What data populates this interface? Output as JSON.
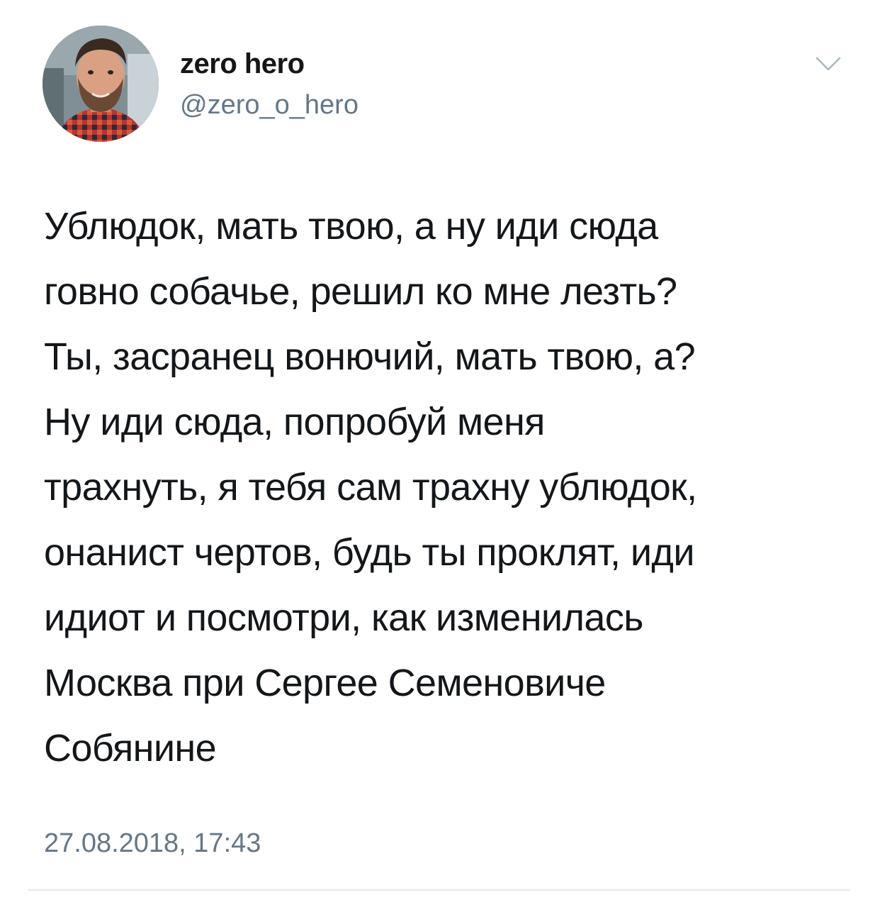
{
  "author": {
    "display_name": "zero hero",
    "handle": "@zero_o_hero",
    "avatar_icon": "profile-photo"
  },
  "menu": {
    "icon": "chevron-down-icon"
  },
  "tweet": {
    "lines": [
      "Ублюдок, мать твою, а ну иди сюда",
      "говно собачье, решил ко мне лезть?",
      "Ты, засранец вонючий, мать твою, а?",
      "Ну иди сюда, попробуй меня",
      "трахнуть, я тебя сам трахну ублюдок,",
      "онанист чертов, будь ты проклят, иди",
      "идиот и посмотри, как изменилась",
      "Москва при Сергее Семеновиче",
      "Собянине"
    ],
    "timestamp": "27.08.2018, 17:43"
  },
  "colors": {
    "text": "#14171a",
    "secondary": "#657786",
    "divider": "#e1e8ed"
  }
}
